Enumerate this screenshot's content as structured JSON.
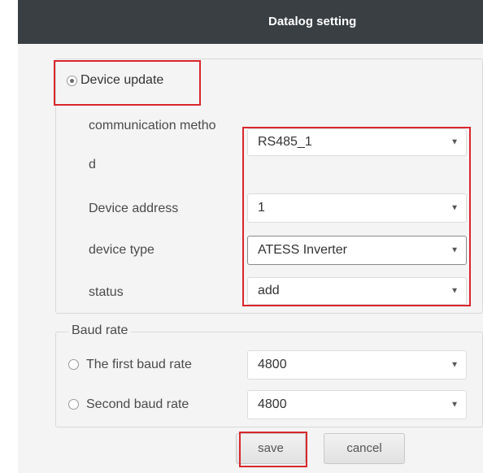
{
  "header": {
    "title": "Datalog setting"
  },
  "device_update": {
    "label": "Device update",
    "selected": true
  },
  "fields": {
    "communication_method": {
      "label_line1": "communication metho",
      "label_line2": "d",
      "value": "RS485_1"
    },
    "device_address": {
      "label": "Device address",
      "value": "1"
    },
    "device_type": {
      "label": "device type",
      "value": "ATESS Inverter"
    },
    "status": {
      "label": "status",
      "value": "add"
    }
  },
  "baud_rate": {
    "legend": "Baud rate",
    "first": {
      "label": "The first baud rate",
      "value": "4800",
      "selected": false
    },
    "second": {
      "label": "Second baud rate",
      "value": "4800",
      "selected": false
    }
  },
  "buttons": {
    "save": "save",
    "cancel": "cancel"
  },
  "colors": {
    "header_bg": "#3a3f44",
    "highlight": "#d9262c"
  },
  "icons": {
    "caret": "caret-down-icon"
  }
}
